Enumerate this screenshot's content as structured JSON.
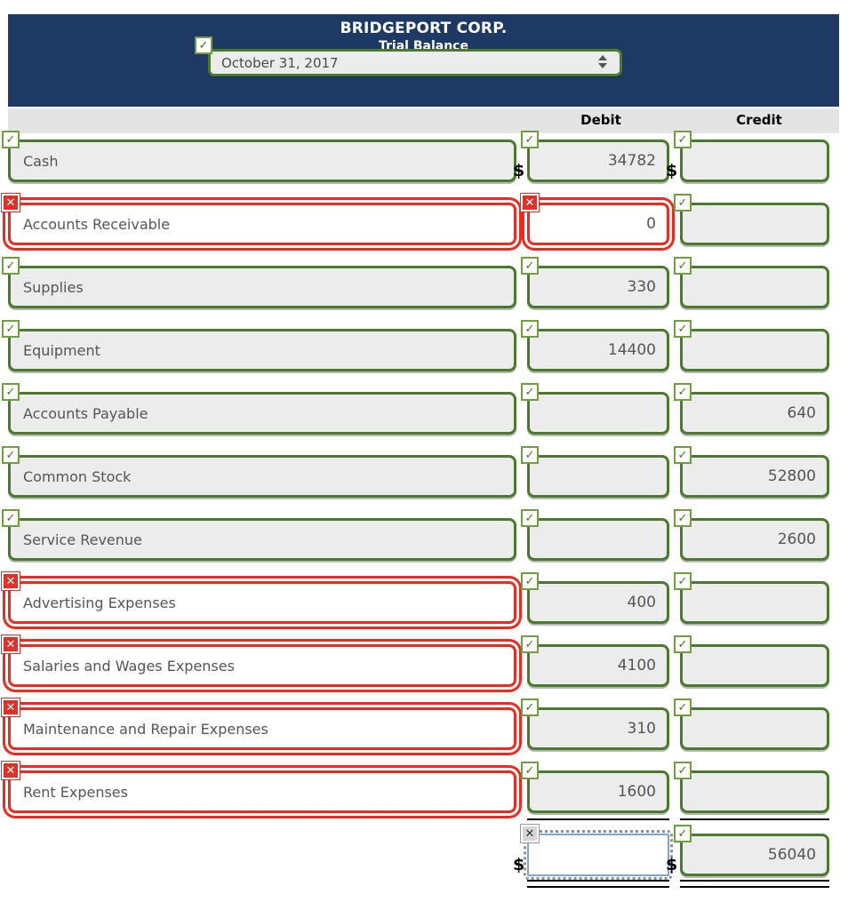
{
  "header": {
    "company": "BRIDGEPORT CORP.",
    "report": "Trial Balance",
    "date_value": "October 31, 2017",
    "date_badge": "✓",
    "stepper_icon": "updown-stepper-icon"
  },
  "columns": {
    "account": "",
    "debit": "Debit",
    "credit": "Credit"
  },
  "symbols": {
    "dollar": "$",
    "check": "✓",
    "cross": "✕",
    "cross_small": "✕"
  },
  "colors": {
    "header_bg": "#1e3a64",
    "strip_bg": "#e4e4e4",
    "valid_border": "#4c7a2c",
    "error_border": "#ee2a20",
    "focus_border": "#7aa7d6",
    "field_bg": "#ececec",
    "text": "#555555"
  },
  "rows": [
    {
      "account": "Cash",
      "account_state": "ok",
      "account_badge": "✓",
      "debit": "34782",
      "debit_state": "ok",
      "debit_badge": "✓",
      "credit": "",
      "credit_state": "ok",
      "credit_badge": "✓",
      "show_dollar": true
    },
    {
      "account": "Accounts Receivable",
      "account_state": "err",
      "account_badge": "✕",
      "debit": "0",
      "debit_state": "err",
      "debit_badge": "✕",
      "credit": "",
      "credit_state": "ok",
      "credit_badge": "✓",
      "show_dollar": false
    },
    {
      "account": "Supplies",
      "account_state": "ok",
      "account_badge": "✓",
      "debit": "330",
      "debit_state": "ok",
      "debit_badge": "✓",
      "credit": "",
      "credit_state": "ok",
      "credit_badge": "✓",
      "show_dollar": false
    },
    {
      "account": "Equipment",
      "account_state": "ok",
      "account_badge": "✓",
      "debit": "14400",
      "debit_state": "ok",
      "debit_badge": "✓",
      "credit": "",
      "credit_state": "ok",
      "credit_badge": "✓",
      "show_dollar": false
    },
    {
      "account": "Accounts Payable",
      "account_state": "ok",
      "account_badge": "✓",
      "debit": "",
      "debit_state": "ok",
      "debit_badge": "✓",
      "credit": "640",
      "credit_state": "ok",
      "credit_badge": "✓",
      "show_dollar": false
    },
    {
      "account": "Common Stock",
      "account_state": "ok",
      "account_badge": "✓",
      "debit": "",
      "debit_state": "ok",
      "debit_badge": "✓",
      "credit": "52800",
      "credit_state": "ok",
      "credit_badge": "✓",
      "show_dollar": false
    },
    {
      "account": "Service Revenue",
      "account_state": "ok",
      "account_badge": "✓",
      "debit": "",
      "debit_state": "ok",
      "debit_badge": "✓",
      "credit": "2600",
      "credit_state": "ok",
      "credit_badge": "✓",
      "show_dollar": false
    },
    {
      "account": "Advertising Expenses",
      "account_state": "err",
      "account_badge": "✕",
      "debit": "400",
      "debit_state": "ok",
      "debit_badge": "✓",
      "credit": "",
      "credit_state": "ok",
      "credit_badge": "✓",
      "show_dollar": false
    },
    {
      "account": "Salaries and Wages Expenses",
      "account_state": "err",
      "account_badge": "✕",
      "debit": "4100",
      "debit_state": "ok",
      "debit_badge": "✓",
      "credit": "",
      "credit_state": "ok",
      "credit_badge": "✓",
      "show_dollar": false
    },
    {
      "account": "Maintenance and Repair Expenses",
      "account_state": "err",
      "account_badge": "✕",
      "debit": "310",
      "debit_state": "ok",
      "debit_badge": "✓",
      "credit": "",
      "credit_state": "ok",
      "credit_badge": "✓",
      "show_dollar": false
    },
    {
      "account": "Rent Expenses",
      "account_state": "err",
      "account_badge": "✕",
      "debit": "1600",
      "debit_state": "ok",
      "debit_badge": "✓",
      "credit": "",
      "credit_state": "ok",
      "credit_badge": "✓",
      "show_dollar": false
    }
  ],
  "totals": {
    "debit": "",
    "debit_state": "focus",
    "debit_badge": "✕",
    "credit": "56040",
    "credit_state": "ok",
    "credit_badge": "✓",
    "show_dollar": true
  }
}
